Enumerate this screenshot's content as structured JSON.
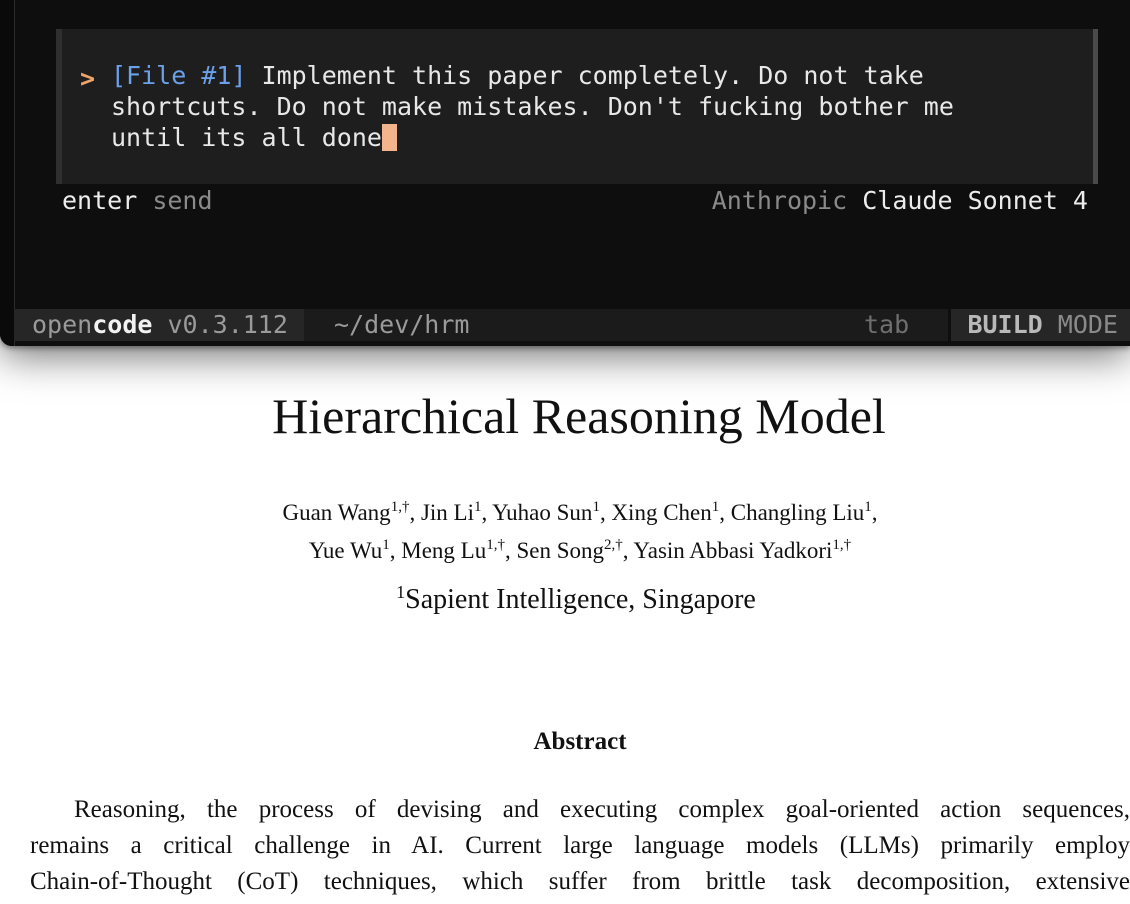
{
  "terminal": {
    "prompt": {
      "caret": ">",
      "file_ref": "[File #1]",
      "message": " Implement this paper completely. Do not take\nshortcuts. Do not make mistakes. Don't fucking bother me\nuntil its all done"
    },
    "hint": {
      "key": "enter",
      "action": "send",
      "provider": "Anthropic",
      "model": "Claude Sonnet 4"
    },
    "status_bar": {
      "app_prefix": "open",
      "app_suffix": "code",
      "version": "v0.3.112",
      "path": "~/dev/hrm",
      "tab_hint": "tab",
      "mode_bold": "BUILD",
      "mode_rest": "MODE"
    }
  },
  "paper": {
    "title": "Hierarchical Reasoning Model",
    "authors": [
      {
        "name": "Guan Wang",
        "sup": "1,†",
        "sep": ", "
      },
      {
        "name": "Jin Li",
        "sup": "1",
        "sep": ", "
      },
      {
        "name": "Yuhao Sun",
        "sup": "1",
        "sep": ", "
      },
      {
        "name": "Xing Chen",
        "sup": "1",
        "sep": ", "
      },
      {
        "name": "Changling Liu",
        "sup": "1",
        "sep": ","
      },
      {
        "name": "Yue Wu",
        "sup": "1",
        "sep": ", "
      },
      {
        "name": "Meng Lu",
        "sup": "1,†",
        "sep": ", "
      },
      {
        "name": "Sen Song",
        "sup": "2,†",
        "sep": ", "
      },
      {
        "name": "Yasin Abbasi Yadkori",
        "sup": "1,†",
        "sep": ""
      }
    ],
    "affiliation": {
      "sup": "1",
      "text": "Sapient Intelligence, Singapore"
    },
    "abstract_heading": "Abstract",
    "abstract_lines": [
      "Reasoning, the process of devising and executing complex goal-oriented action sequences,",
      "remains a critical challenge in AI. Current large language models (LLMs) primarily employ",
      "Chain-of-Thought (CoT) techniques, which suffer from brittle task decomposition, extensive"
    ]
  }
}
